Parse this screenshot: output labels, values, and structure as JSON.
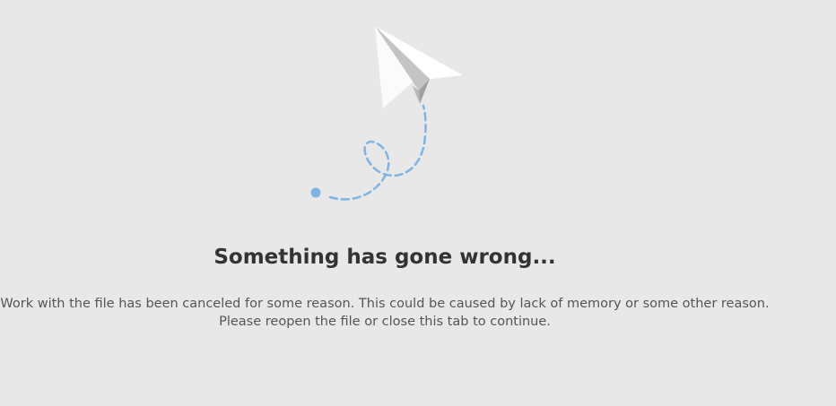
{
  "error_page": {
    "title": "Something has gone wrong...",
    "message_line_1": "Work with the file has been canceled for some reason. This could be caused by lack of memory or some other reason.",
    "message_line_2": "Please reopen the file or close this tab to continue."
  },
  "illustration": {
    "icon": "paper-plane-icon",
    "trail_color": "#7fb3e4",
    "plane_color": "#ffffff",
    "plane_shadow_color": "#a8a8a8"
  },
  "colors": {
    "background": "#e8e8e8",
    "title": "#333333",
    "text": "#555555"
  }
}
